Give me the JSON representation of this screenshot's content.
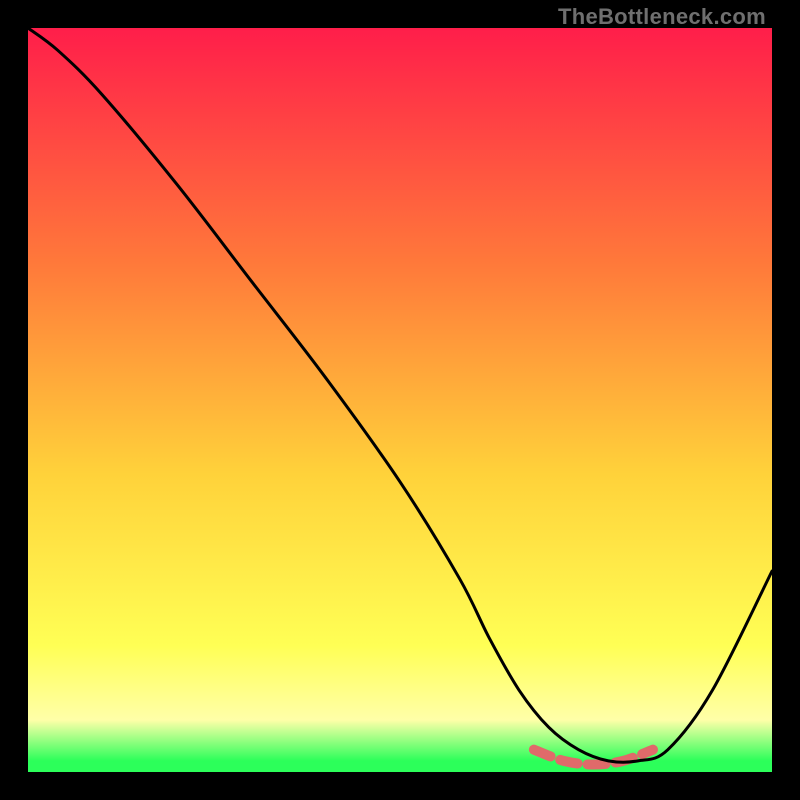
{
  "watermark": "TheBottleneck.com",
  "colors": {
    "black": "#000000",
    "grad_top": "#ff1e4a",
    "grad_mid1": "#ff7a3a",
    "grad_mid2": "#ffd23a",
    "grad_low": "#ffff55",
    "grad_pale": "#ffffa8",
    "grad_green": "#2cff5a",
    "curve": "#000000",
    "highlight": "#e06a6a"
  },
  "chart_data": {
    "type": "line",
    "title": "",
    "xlabel": "",
    "ylabel": "",
    "xlim": [
      0,
      100
    ],
    "ylim": [
      0,
      100
    ],
    "series": [
      {
        "name": "bottleneck-curve",
        "x": [
          0,
          4,
          10,
          20,
          30,
          40,
          50,
          58,
          62,
          66,
          70,
          74,
          78,
          82,
          86,
          92,
          100
        ],
        "values": [
          100,
          97,
          91,
          79,
          66,
          53,
          39,
          26,
          18,
          11,
          6,
          3,
          1.5,
          1.5,
          3,
          11,
          27
        ]
      },
      {
        "name": "optimal-band",
        "x": [
          68,
          72,
          76,
          80,
          84
        ],
        "values": [
          3,
          1.5,
          1,
          1.5,
          3
        ]
      }
    ]
  }
}
